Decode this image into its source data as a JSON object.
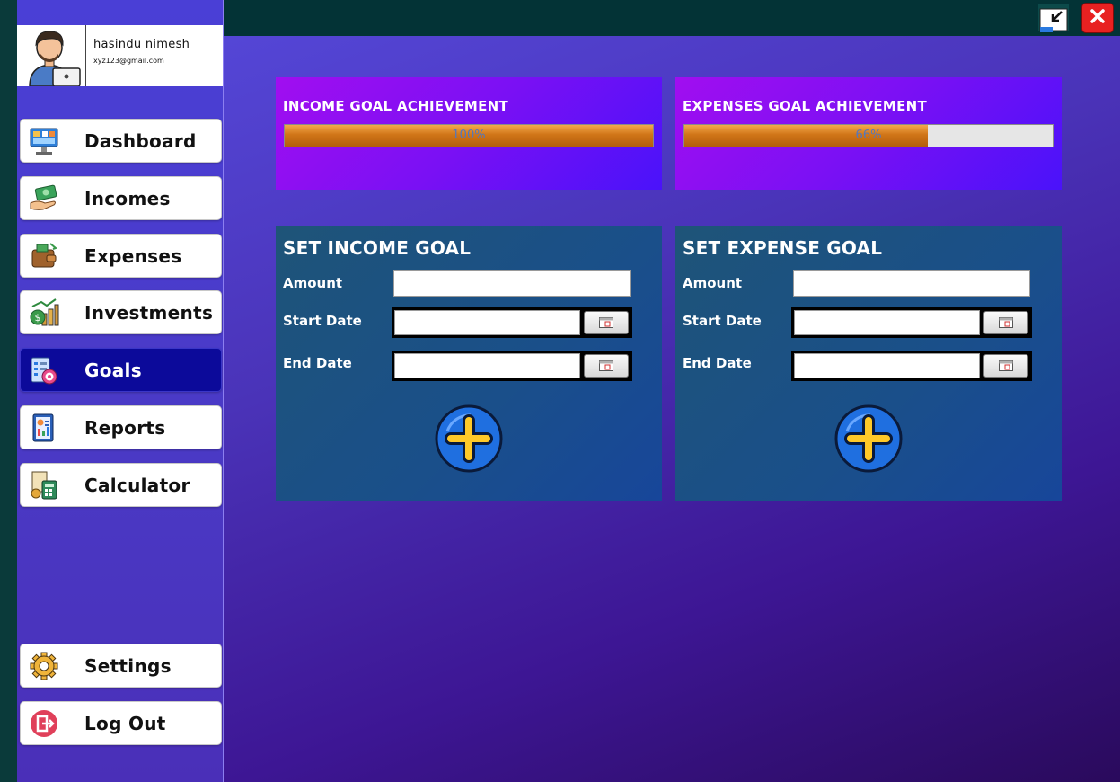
{
  "user": {
    "name": "hasindu nimesh",
    "email": "xyz123@gmail.com"
  },
  "sidebar": {
    "items": [
      {
        "label": "Dashboard",
        "icon": "dashboard-icon"
      },
      {
        "label": "Incomes",
        "icon": "money-hand-icon"
      },
      {
        "label": "Expenses",
        "icon": "wallet-icon"
      },
      {
        "label": "Investments",
        "icon": "investment-chart-icon"
      },
      {
        "label": "Goals",
        "icon": "goals-checklist-icon",
        "active": true
      },
      {
        "label": "Reports",
        "icon": "report-icon"
      },
      {
        "label": "Calculator",
        "icon": "calculator-icon"
      }
    ],
    "bottom": [
      {
        "label": "Settings",
        "icon": "gear-icon"
      },
      {
        "label": "Log Out",
        "icon": "logout-icon"
      }
    ]
  },
  "window": {
    "restore_icon": "restore-window-icon",
    "close_icon": "close-icon"
  },
  "income_goal": {
    "title": "INCOME GOAL ACHIEVEMENT",
    "progress_text": "100%",
    "progress": 1.0
  },
  "expense_goal": {
    "title": "EXPENSES GOAL ACHIEVEMENT",
    "progress_text": "66%",
    "progress": 0.66
  },
  "set_income_goal": {
    "title": "SET INCOME GOAL",
    "amount_label": "Amount",
    "amount_value": "",
    "start_label": "Start Date",
    "start_value": "",
    "end_label": "End Date",
    "end_value": ""
  },
  "set_expense_goal": {
    "title": "SET EXPENSE GOAL",
    "amount_label": "Amount",
    "amount_value": "",
    "start_label": "Start Date",
    "start_value": "",
    "end_label": "End Date",
    "end_value": ""
  },
  "colors": {
    "accent_active": "#0c0a9a",
    "close_red": "#e82121",
    "progress_orange": "#d07518",
    "add_blue": "#1f6fe0",
    "add_plus": "#ffc928"
  }
}
